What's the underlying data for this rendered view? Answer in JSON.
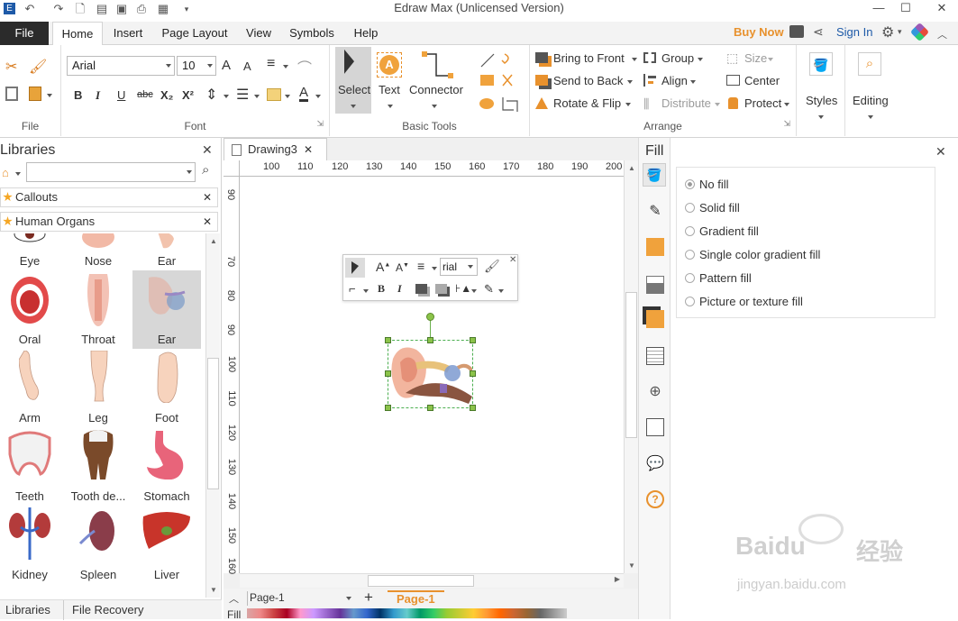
{
  "app": {
    "title": "Edraw Max (Unlicensed Version)"
  },
  "tabs": [
    "File",
    "Home",
    "Insert",
    "Page Layout",
    "View",
    "Symbols",
    "Help"
  ],
  "account": {
    "buy_now": "Buy Now",
    "sign_in": "Sign In"
  },
  "ribbon": {
    "file_group": "File",
    "font": {
      "family": "Arial",
      "size": "10",
      "group": "Font",
      "bold": "B",
      "italic": "I",
      "underline": "U",
      "strike": "abc",
      "sub": "X₂",
      "sup": "X²",
      "a_big": "A",
      "a_small": "A"
    },
    "basic_tools": {
      "select": "Select",
      "text": "Text",
      "connector": "Connector",
      "group": "Basic Tools"
    },
    "arrange": {
      "bring_to_front": "Bring to Front",
      "send_to_back": "Send to Back",
      "rotate_flip": "Rotate & Flip",
      "group_btn": "Group",
      "align": "Align",
      "distribute": "Distribute",
      "size": "Size",
      "center": "Center",
      "protect": "Protect",
      "group": "Arrange"
    },
    "styles": "Styles",
    "editing": "Editing"
  },
  "libraries": {
    "title": "Libraries",
    "bars": [
      "Callouts",
      "Human Organs"
    ],
    "items": [
      {
        "label": "Eye"
      },
      {
        "label": "Nose"
      },
      {
        "label": "Ear"
      },
      {
        "label": "Oral"
      },
      {
        "label": "Throat"
      },
      {
        "label": "Ear"
      },
      {
        "label": "Arm"
      },
      {
        "label": "Leg"
      },
      {
        "label": "Foot"
      },
      {
        "label": "Teeth"
      },
      {
        "label": "Tooth de..."
      },
      {
        "label": "Stomach"
      },
      {
        "label": "Kidney"
      },
      {
        "label": "Spleen"
      },
      {
        "label": "Liver"
      }
    ],
    "bottom_tabs": [
      "Libraries",
      "File Recovery"
    ]
  },
  "document": {
    "tab": "Drawing3",
    "ruler_h": [
      "100",
      "110",
      "120",
      "130",
      "140",
      "150",
      "160",
      "170",
      "180",
      "190",
      "200"
    ],
    "ruler_v": [
      "90",
      "70",
      "80",
      "90",
      "100",
      "110",
      "120",
      "130",
      "140",
      "150",
      "160"
    ],
    "mini_font": "rial",
    "page_select": "Page-1",
    "page_tab": "Page-1",
    "fill_label": "Fill"
  },
  "fill_panel": {
    "title": "Fill",
    "options": [
      "No fill",
      "Solid fill",
      "Gradient fill",
      "Single color gradient fill",
      "Pattern fill",
      "Picture or texture fill"
    ],
    "selected": "No fill"
  },
  "watermark": {
    "brand": "Baidu",
    "cn": "经验",
    "url": "jingyan.baidu.com"
  }
}
